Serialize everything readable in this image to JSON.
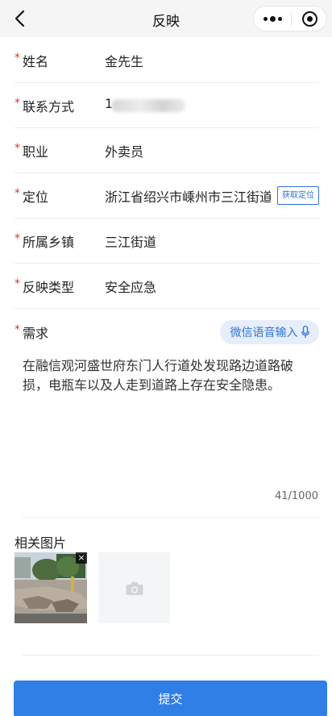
{
  "nav": {
    "title": "反映"
  },
  "fields": [
    {
      "label": "姓名",
      "value": "金先生",
      "required": "*"
    },
    {
      "label": "联系方式",
      "value": "1",
      "required": "*"
    },
    {
      "label": "职业",
      "value": "外卖员",
      "required": "*"
    },
    {
      "label": "定位",
      "value": "浙江省绍兴市嵊州市三江街道",
      "required": "*",
      "action": "获取定位"
    },
    {
      "label": "所属乡镇",
      "value": "三江街道",
      "required": "*"
    },
    {
      "label": "反映类型",
      "value": "安全应急",
      "required": "*"
    }
  ],
  "need": {
    "label": "需求",
    "required": "*",
    "voice_label": "微信语音输入",
    "text": "在融信观河盛世府东门人行道处发现路边道路破损，电瓶车以及人走到道路上存在安全隐患。",
    "counter": "41/1000"
  },
  "photos": {
    "label": "相关图片",
    "delete_glyph": "×"
  },
  "submit_label": "提交",
  "icons": [
    "back-arrow-icon",
    "more-dots-icon",
    "target-icon",
    "mic-icon",
    "close-icon",
    "camera-icon"
  ],
  "colors": {
    "accent": "#2f73d9",
    "required": "#e0332c",
    "submit": "#2f7fe6"
  }
}
